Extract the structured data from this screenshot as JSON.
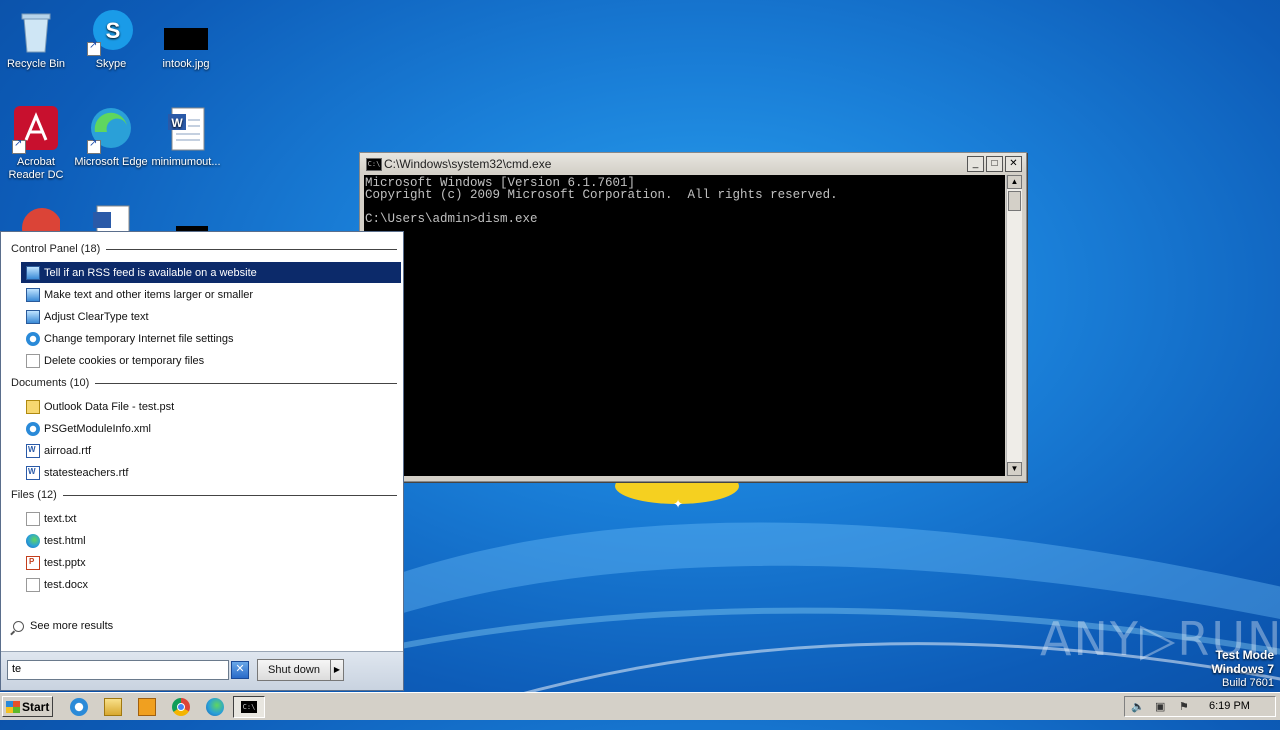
{
  "desktop": {
    "icons": [
      {
        "label": "Recycle Bin"
      },
      {
        "label": "Skype"
      },
      {
        "label": "intook.jpg"
      },
      {
        "label": "Acrobat Reader DC"
      },
      {
        "label": "Microsoft Edge"
      },
      {
        "label": "minimumout..."
      }
    ]
  },
  "cmd_window": {
    "title": "C:\\Windows\\system32\\cmd.exe",
    "icon_text": "C:\\",
    "buttons": {
      "minimize": "_",
      "maximize": "□",
      "close": "✕"
    },
    "console_lines": [
      "Microsoft Windows [Version 6.1.7601]",
      "Copyright (c) 2009 Microsoft Corporation.  All rights reserved.",
      "",
      "C:\\Users\\admin>dism.exe"
    ]
  },
  "start_menu": {
    "sections": [
      {
        "header": "Control Panel (18)",
        "items": [
          {
            "label": "Tell if an RSS feed is available on a website",
            "icon": "control-panel-icon",
            "selected": true
          },
          {
            "label": "Make text and other items larger or smaller",
            "icon": "control-panel-icon"
          },
          {
            "label": "Adjust ClearType text",
            "icon": "control-panel-icon"
          },
          {
            "label": "Change temporary Internet file settings",
            "icon": "internet-options-icon"
          },
          {
            "label": "Delete cookies or temporary files",
            "icon": "document-icon"
          }
        ]
      },
      {
        "header": "Documents (10)",
        "items": [
          {
            "label": "Outlook Data File - test.pst",
            "icon": "outlook-data-icon"
          },
          {
            "label": "PSGetModuleInfo.xml",
            "icon": "xml-icon"
          },
          {
            "label": "airroad.rtf",
            "icon": "word-doc-icon"
          },
          {
            "label": "statesteachers.rtf",
            "icon": "word-doc-icon"
          }
        ]
      },
      {
        "header": "Files (12)",
        "items": [
          {
            "label": "text.txt",
            "icon": "text-file-icon"
          },
          {
            "label": "test.html",
            "icon": "edge-icon"
          },
          {
            "label": "test.pptx",
            "icon": "powerpoint-icon"
          },
          {
            "label": "test.docx",
            "icon": "document-icon"
          }
        ]
      }
    ],
    "see_more": "See more results",
    "search_value": "te",
    "clear_symbol": "✕",
    "shutdown_label": "Shut down",
    "shutdown_arrow": "▶"
  },
  "taskbar": {
    "start_label": "Start",
    "clock": "6:19 PM"
  },
  "watermark": {
    "brand": "ANY▷RUN",
    "test_mode": "Test Mode",
    "os": "Windows 7",
    "build": "Build 7601"
  }
}
